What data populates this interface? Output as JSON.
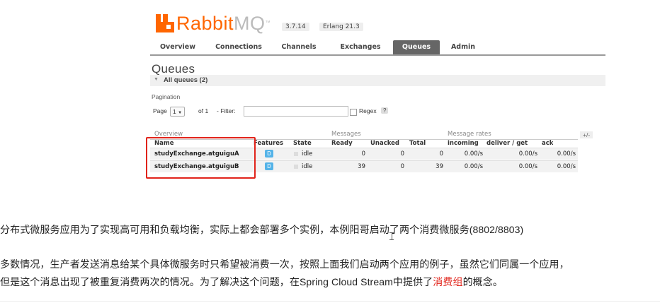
{
  "app": {
    "brand_main": "Rabbit",
    "brand_mq": "MQ",
    "brand_tm": "™",
    "version_badge": "3.7.14",
    "erlang_badge": "Erlang 21.3",
    "brand_color": "#ff6600"
  },
  "tabs": [
    {
      "label": "Overview",
      "active": false
    },
    {
      "label": "Connections",
      "active": false
    },
    {
      "label": "Channels",
      "active": false
    },
    {
      "label": "Exchanges",
      "active": false
    },
    {
      "label": "Queues",
      "active": true
    },
    {
      "label": "Admin",
      "active": false
    }
  ],
  "page": {
    "title": "Queues",
    "all_queues_label": "All queues (2)",
    "pagination_label": "Pagination",
    "page_word": "Page",
    "page_value": "1",
    "page_select_arrow": "▼",
    "of_text": "of 1",
    "filter_label": "- Filter:",
    "filter_value": "",
    "regex_label": "Regex",
    "regex_help": "?"
  },
  "table": {
    "group_headers": {
      "overview": "Overview",
      "messages": "Messages",
      "message_rates": "Message rates",
      "toggle": "+/-"
    },
    "columns": [
      "Name",
      "Features",
      "State",
      "Ready",
      "Unacked",
      "Total",
      "incoming",
      "deliver / get",
      "ack"
    ],
    "rows": [
      {
        "name": "studyExchange.atguiguA",
        "feature": "D",
        "state": "idle",
        "ready": "0",
        "unacked": "0",
        "total": "0",
        "incoming": "0.00/s",
        "deliver_get": "0.00/s",
        "ack": "0.00/s"
      },
      {
        "name": "studyExchange.atguiguB",
        "feature": "D",
        "state": "idle",
        "ready": "39",
        "unacked": "0",
        "total": "39",
        "incoming": "0.00/s",
        "deliver_get": "0.00/s",
        "ack": "0.00/s"
      }
    ],
    "feature_badge_color": "#54b3e8",
    "highlight_color": "#e1241b"
  },
  "article": {
    "para1": "分布式微服务应用为了实现高可用和负载均衡，实际上都会部署多个实例，本例阳哥启动了两个消费微服务(8802/8803)",
    "para2_line1": "多数情况，生产者发送消息给某个具体微服务时只希望被消费一次，按照上面我们启动两个应用的例子，虽然它们同属一个应用，",
    "para2_line2_pre": "但是这个消息出现了被重复消费两次的情况。为了解决这个问题，在Spring Cloud Stream中提供了",
    "para2_line2_highlight": "消费组",
    "para2_line2_post": "的概念。"
  }
}
